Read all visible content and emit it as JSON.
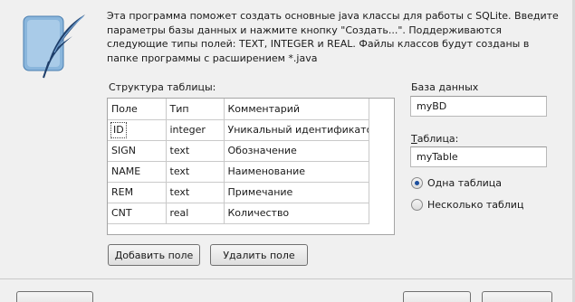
{
  "intro": {
    "text": "Эта программа поможет создать основные java классы для работы с  SQLite. Введите параметры базы данных и нажмите кнопку \"Создать...\". Поддерживаются следующие типы полей: TEXT, INTEGER и REAL. Файлы классов будут созданы в папке программы с расширением *.java"
  },
  "structure": {
    "label": "Структура таблицы:",
    "columns": [
      "Поле",
      "Тип",
      "Комментарий"
    ],
    "rows": [
      {
        "field": "ID",
        "type": "integer",
        "comment": "Уникальный идентификато"
      },
      {
        "field": "SIGN",
        "type": "text",
        "comment": "Обозначение"
      },
      {
        "field": "NAME",
        "type": "text",
        "comment": "Наименование"
      },
      {
        "field": "REM",
        "type": "text",
        "comment": "Примечание"
      },
      {
        "field": "CNT",
        "type": "real",
        "comment": "Количество"
      }
    ]
  },
  "database": {
    "label": "База данных",
    "value": "myBD"
  },
  "table": {
    "label_underlined": "Т",
    "label_rest": "аблица:",
    "value": "myTable"
  },
  "mode": {
    "single": "Одна таблица",
    "multiple": "Несколько таблиц",
    "selected": "single"
  },
  "buttons": {
    "add_field": "Добавить поле",
    "delete_field": "Удалить поле"
  },
  "colors": {
    "background": "#f0f0f0",
    "radio_dot": "#1d4f9e"
  }
}
